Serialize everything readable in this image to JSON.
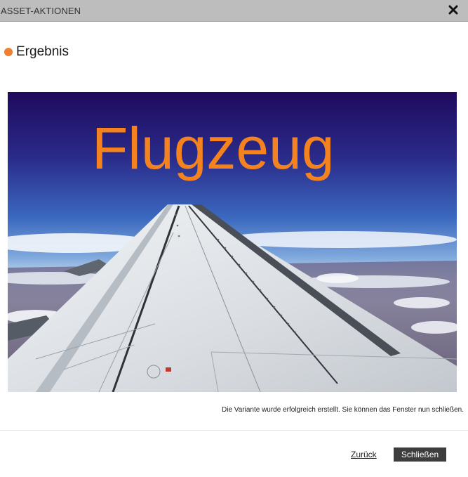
{
  "dialog": {
    "title": "ASSET-AKTIONEN",
    "close_icon": "close-x-icon"
  },
  "result": {
    "heading": "Ergebnis",
    "bullet_color": "#ee8033",
    "image": {
      "subject": "airplane wing above clouds",
      "overlay_text": "Flugzeug",
      "overlay_color": "#f4831f"
    }
  },
  "message": "Die Variante wurde erfolgreich erstellt. Sie können das Fenster nun schließen.",
  "footer": {
    "back_label": "Zurück",
    "close_label": "Schließen"
  }
}
